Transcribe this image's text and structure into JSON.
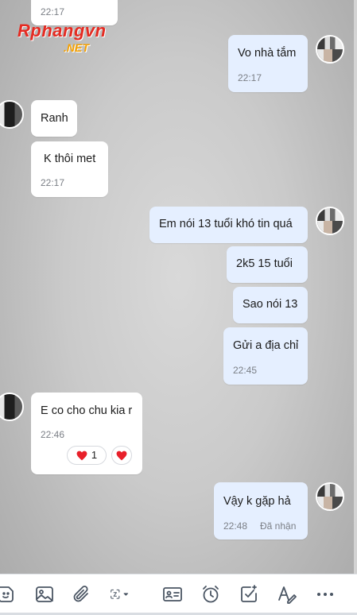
{
  "logo": {
    "main": "Rphangvn",
    "sub": ".NET"
  },
  "messages": [
    {
      "id": "m0",
      "side": "in",
      "text": "",
      "time": "22:17"
    },
    {
      "id": "m1",
      "side": "out",
      "text": "Vo nhà tắm",
      "time": "22:17"
    },
    {
      "id": "m2",
      "side": "in",
      "text": "Ranh",
      "time": ""
    },
    {
      "id": "m3",
      "side": "in",
      "text": "K thôi met",
      "time": "22:17"
    },
    {
      "id": "m4",
      "side": "out",
      "text": "Em nói 13 tuổi khó tin quá",
      "time": ""
    },
    {
      "id": "m5",
      "side": "out",
      "text": "2k5  15 tuổi",
      "time": ""
    },
    {
      "id": "m6",
      "side": "out",
      "text": "Sao nói 13",
      "time": ""
    },
    {
      "id": "m7",
      "side": "out",
      "text": "Gửi a địa chỉ",
      "time": "22:45"
    },
    {
      "id": "m8",
      "side": "in",
      "text": "E co cho chu kia r",
      "time": "22:46",
      "reaction_count": "1"
    },
    {
      "id": "m9",
      "side": "out",
      "text": "Vậy k gặp hả",
      "time": "22:48",
      "status": "Đã nhận"
    }
  ],
  "colors": {
    "heart": "#e8202a",
    "outgoing_bubble": "#e5efff",
    "incoming_bubble": "#ffffff"
  },
  "toolbar": [
    "sticker-icon",
    "image-icon",
    "attachment-icon",
    "zalo-screenshot-icon",
    "contact-card-icon",
    "reminder-clock-icon",
    "task-checkbox-icon",
    "text-format-icon",
    "more-icon"
  ]
}
